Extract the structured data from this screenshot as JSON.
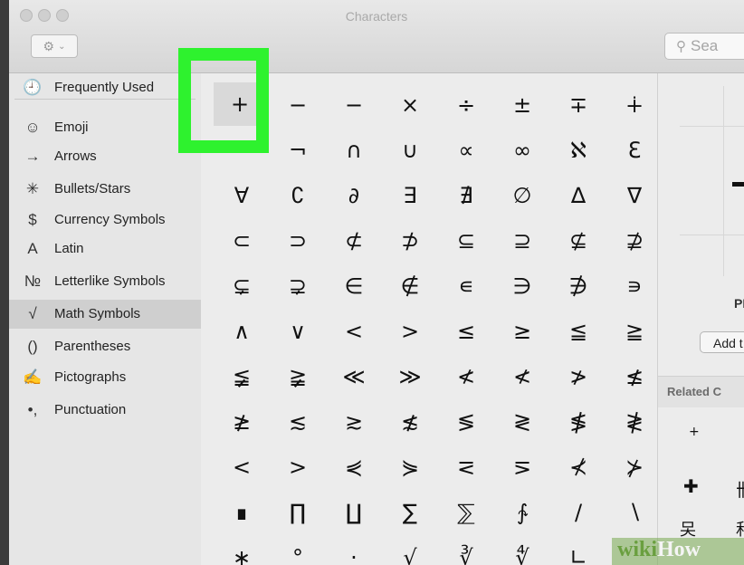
{
  "window": {
    "title": "Characters"
  },
  "toolbar": {
    "gear_icon": "⚙",
    "chevron_icon": "⌄"
  },
  "search": {
    "icon": "⚲",
    "placeholder": "Sea"
  },
  "sidebar": {
    "items": [
      {
        "icon": "🕘",
        "label": "Frequently Used"
      },
      {
        "icon": "☺",
        "label": "Emoji"
      },
      {
        "icon": "→",
        "label": "Arrows"
      },
      {
        "icon": "✳",
        "label": "Bullets/Stars"
      },
      {
        "icon": "$",
        "label": "Currency Symbols"
      },
      {
        "icon": "A",
        "label": "Latin"
      },
      {
        "icon": "№",
        "label": "Letterlike Symbols"
      },
      {
        "icon": "√",
        "label": "Math Symbols"
      },
      {
        "icon": "()",
        "label": "Parentheses"
      },
      {
        "icon": "✍",
        "label": "Pictographs"
      },
      {
        "icon": "•,",
        "label": "Punctuation"
      }
    ],
    "selected": "Math Symbols"
  },
  "characters": [
    [
      "+",
      "−",
      "−",
      "×",
      "÷",
      "±",
      "∓",
      "∔"
    ],
    [
      "−",
      "¬",
      "∩",
      "∪",
      "∝",
      "∞",
      "ℵ",
      "ℇ"
    ],
    [
      "∀",
      "∁",
      "∂",
      "∃",
      "∄",
      "∅",
      "∆",
      "∇"
    ],
    [
      "⊂",
      "⊃",
      "⊄",
      "⊅",
      "⊆",
      "⊇",
      "⊈",
      "⊉"
    ],
    [
      "⊊",
      "⊋",
      "∈",
      "∉",
      "∊",
      "∋",
      "∌",
      "∍"
    ],
    [
      "∧",
      "∨",
      "<",
      ">",
      "≤",
      "≥",
      "≦",
      "≧"
    ],
    [
      "≨",
      "≩",
      "≪",
      "≫",
      "≮",
      "≮",
      "≯",
      "≰"
    ],
    [
      "≱",
      "≲",
      "≳",
      "≴",
      "≶",
      "≷",
      "≸",
      "≹"
    ],
    [
      "<",
      ">",
      "⋞",
      "⋟",
      "⋜",
      "⋝",
      "⊀",
      "⊁"
    ],
    [
      "∎",
      "∏",
      "∐",
      "∑",
      "⅀",
      "∱",
      "/",
      "∖"
    ],
    [
      "∗",
      "°",
      "·",
      "√",
      "∛",
      "∜",
      "∟",
      ""
    ]
  ],
  "details": {
    "name": "PL",
    "add_button": "Add t",
    "related_title": "Related C",
    "related_chars": [
      "+",
      "+",
      "✚",
      "卌",
      "㕦",
      "和"
    ]
  },
  "watermark": {
    "wiki": "wiki",
    "how": "How"
  }
}
